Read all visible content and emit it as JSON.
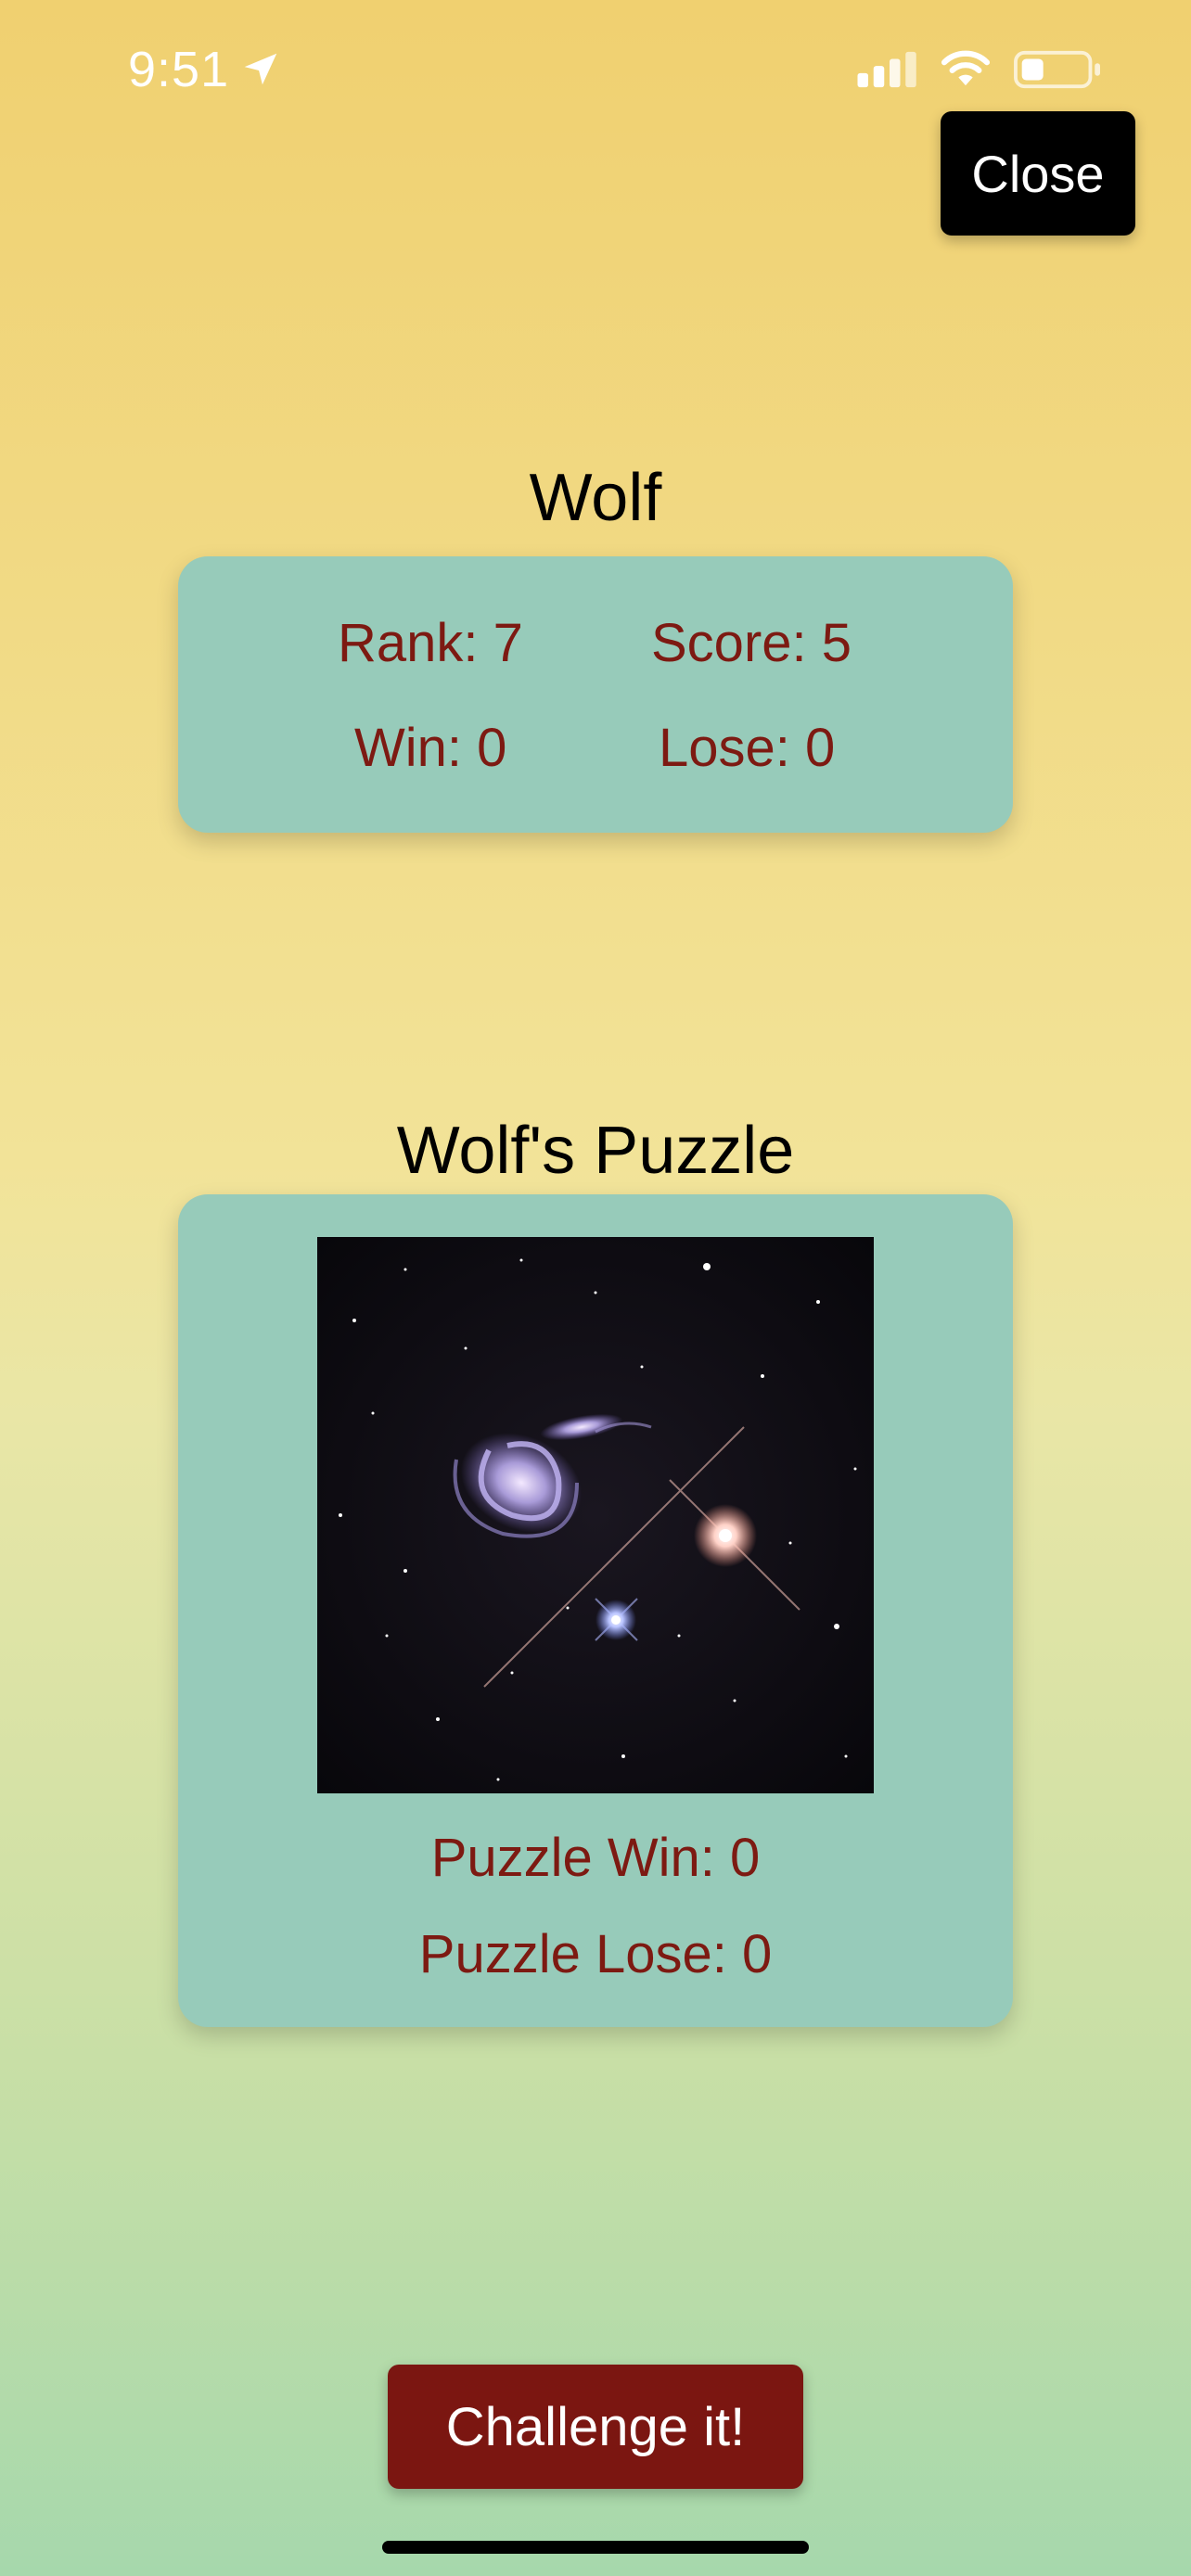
{
  "status": {
    "time": "9:51"
  },
  "close_label": "Close",
  "player": {
    "name": "Wolf",
    "rank": "Rank: 7",
    "score": "Score: 5",
    "win": "Win: 0",
    "lose": "Lose: 0"
  },
  "puzzle": {
    "title": "Wolf's Puzzle",
    "win": "Puzzle Win: 0",
    "lose": "Puzzle Lose: 0"
  },
  "challenge_label": "Challenge it!",
  "colors": {
    "card": "#97cbba",
    "stat_text": "#7d1a12",
    "challenge_bg": "#7b1611"
  },
  "icons": [
    "location-arrow-icon",
    "cellular-signal-icon",
    "wifi-icon",
    "battery-icon"
  ]
}
